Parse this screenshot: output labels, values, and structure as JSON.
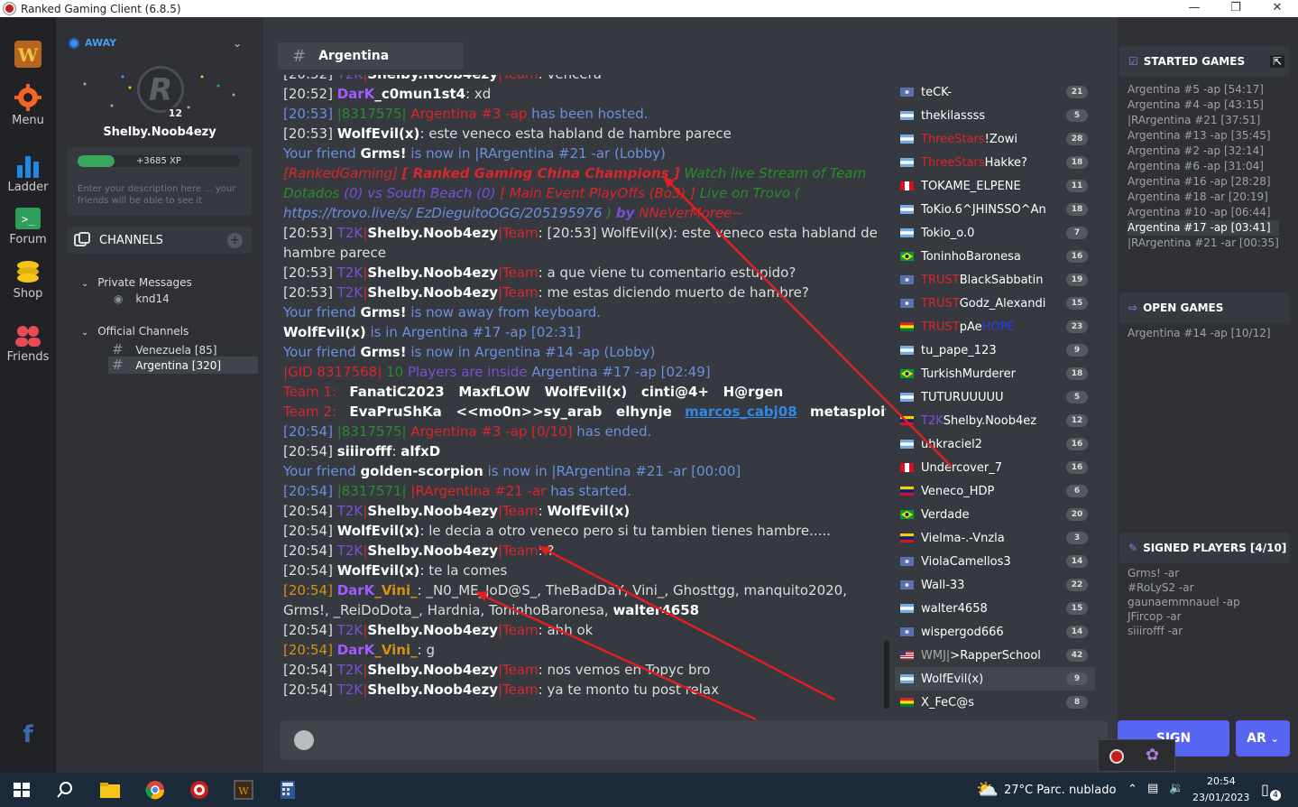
{
  "window": {
    "title": "Ranked Gaming Client (6.8.5)"
  },
  "rail": {
    "menu": "Menu",
    "ladder": "Ladder",
    "forum": "Forum",
    "shop": "Shop",
    "friends": "Friends"
  },
  "profile": {
    "status": "AWAY",
    "username": "Shelby.Noob4ezy",
    "level": "12",
    "xp": "+3685 XP",
    "xp_progress": 0.23,
    "description_placeholder": "Enter your description here ... your friends will be able to see it"
  },
  "channels": {
    "header": "CHANNELS",
    "private_group": "Private Messages",
    "private_items": [
      "knd14"
    ],
    "official_group": "Official Channels",
    "official_items": [
      "Venezuela [85]",
      "Argentina [320]"
    ]
  },
  "chat": {
    "channel": "Argentina"
  },
  "userlist": [
    {
      "name": "teCK-",
      "count": "21",
      "flag": "ar-blue"
    },
    {
      "name": "thekilassss",
      "count": "5",
      "flag": "ar"
    },
    {
      "name_pre": "ThreeStars",
      "name": "!Zowi",
      "count": "28",
      "flag": "ar"
    },
    {
      "name_pre": "ThreeStars",
      "name": "Hakke?",
      "count": "18",
      "flag": "ar"
    },
    {
      "name": "TOKAME_ELPENE",
      "count": "11",
      "flag": "pe"
    },
    {
      "name": "ToKio.6^JHINSSO^An",
      "count": "18",
      "flag": "ar"
    },
    {
      "name": "Tokio_o.0",
      "count": "7",
      "flag": "ar"
    },
    {
      "name": "ToninhoBaronesa",
      "count": "16",
      "flag": "br"
    },
    {
      "name_pre": "TRUST",
      "name": "BlackSabbatin",
      "count": "19",
      "flag": "ar-blue"
    },
    {
      "name_pre": "TRUST",
      "name": "Godz_Alexandi",
      "count": "15",
      "flag": "ar-blue"
    },
    {
      "name_pre": "TRUST",
      "name": "pAe",
      "name_post": "HOPE",
      "count": "23",
      "flag": "bo"
    },
    {
      "name": "tu_pape_123",
      "count": "9",
      "flag": "ar"
    },
    {
      "name": "TurkishMurderer",
      "count": "18",
      "flag": "br"
    },
    {
      "name": "TUTURUUUUU",
      "count": "5",
      "flag": "ar"
    },
    {
      "name_pre": "T2K",
      "name": "Shelby.Noob4ez",
      "count": "12",
      "flag": "ve"
    },
    {
      "name": "uhkraciel2",
      "count": "16",
      "flag": "ar"
    },
    {
      "name": "Undercover_7",
      "count": "16",
      "flag": "pe"
    },
    {
      "name": "Veneco_HDP",
      "count": "6",
      "flag": "ve"
    },
    {
      "name": "Verdade",
      "count": "20",
      "flag": "br"
    },
    {
      "name": "Vielma-.-Vnzla",
      "count": "3",
      "flag": "ve"
    },
    {
      "name": "ViolaCamellos3",
      "count": "14",
      "flag": "ar-blue"
    },
    {
      "name": "Wall-33",
      "count": "22",
      "flag": "ar-blue"
    },
    {
      "name": "walter4658",
      "count": "15",
      "flag": "ar"
    },
    {
      "name": "wispergod666",
      "count": "14",
      "flag": "ar-blue"
    },
    {
      "name_pre": "WMJ|",
      "name": ">RapperSchool",
      "count": "42",
      "flag": "us"
    },
    {
      "name": "WolfEvil(x)",
      "count": "9",
      "flag": "ar",
      "selected": true
    },
    {
      "name": "X_FeC@s",
      "count": "8",
      "flag": "bo"
    }
  ],
  "started_games": {
    "title": "STARTED GAMES",
    "items": [
      "Argentina #5 -ap [54:17]",
      "Argentina #4 -ap [43:15]",
      "|RArgentina #21 [37:51]",
      "Argentina #13 -ap [35:45]",
      "Argentina #2 -ap [32:14]",
      "Argentina #6 -ap [31:04]",
      "Argentina #16 -ap [28:28]",
      "Argentina #18 -ar [20:19]",
      "Argentina #10 -ap [06:44]",
      "Argentina #17 -ap [03:41]",
      "|RArgentina #21 -ar [00:35]"
    ]
  },
  "open_games": {
    "title": "OPEN GAMES",
    "items": [
      "Argentina #14 -ap [10/12]"
    ]
  },
  "signed_players": {
    "title": "SIGNED PLAYERS [4/10]",
    "items": [
      "Grms! -ar",
      "#RoLyS2 -ar",
      "gaunaemmnauel -ap",
      "JFircop -ar",
      "siiirofff -ar"
    ]
  },
  "buttons": {
    "sign": "SIGN",
    "region": "AR"
  },
  "taskbar": {
    "weather": "27°C  Parc. nublado",
    "time": "20:54",
    "date": "23/01/2023",
    "notif": "4"
  },
  "colors": {
    "accent": "#5865f2",
    "away": "#3b8de9",
    "red": "#d8262a",
    "team_blue": "#6c8fdd"
  }
}
